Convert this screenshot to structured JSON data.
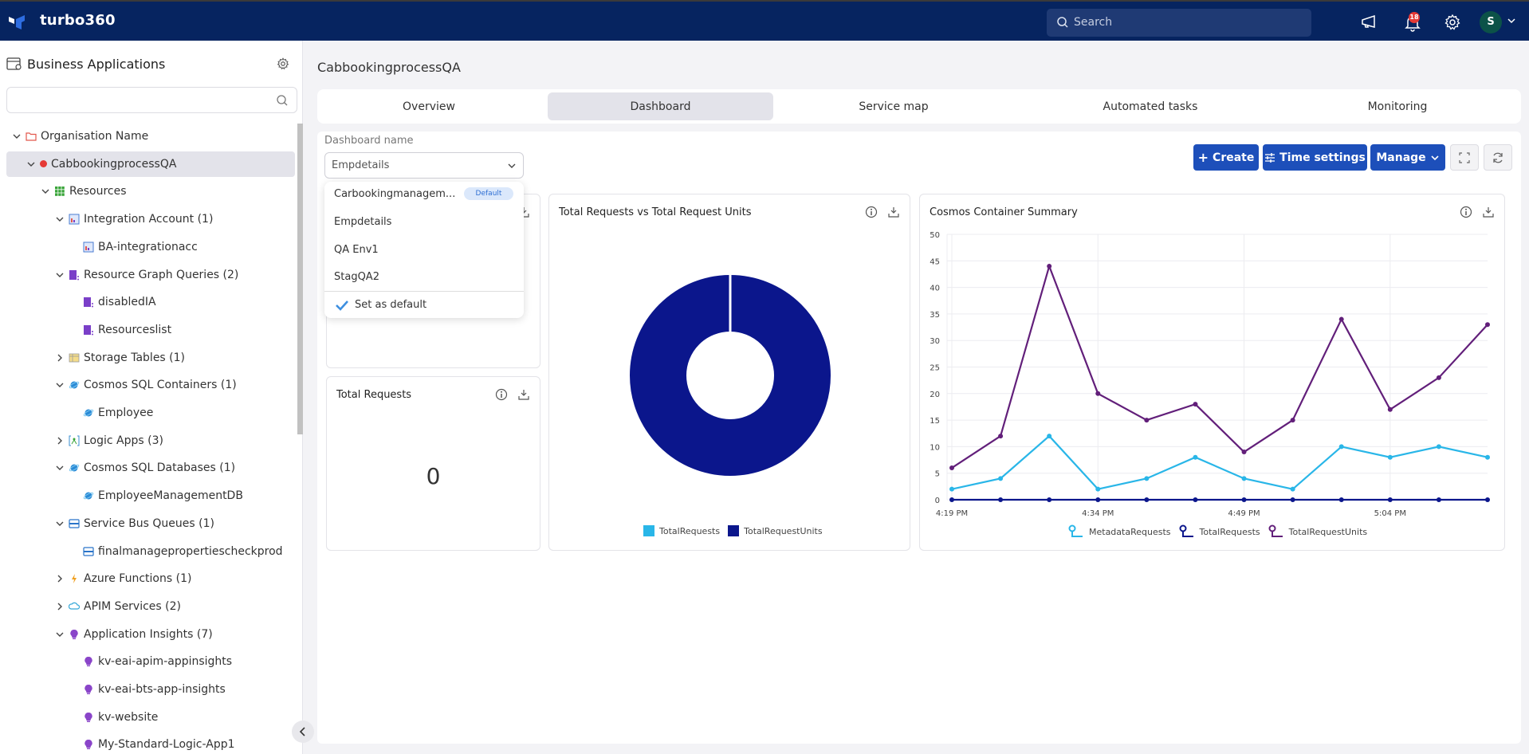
{
  "app": {
    "brand": "turbo360",
    "search_placeholder": "Search",
    "notification_count": "18",
    "avatar_initial": "S"
  },
  "sidebar": {
    "title": "Business Applications",
    "search_value": "",
    "tree": [
      {
        "label": "Organisation Name",
        "level": 0,
        "expanded": true,
        "icon": "folder-icon"
      },
      {
        "label": "CabbookingprocessQA",
        "level": 1,
        "expanded": true,
        "icon": "status-dot-icon",
        "selected": true
      },
      {
        "label": "Resources",
        "level": 2,
        "expanded": true,
        "icon": "grid-icon"
      },
      {
        "label": "Integration Account (1)",
        "level": 3,
        "expanded": true,
        "icon": "integration-account-icon"
      },
      {
        "label": "BA-integrationacc",
        "level": 4,
        "icon": "integration-account-icon"
      },
      {
        "label": "Resource Graph Queries (2)",
        "level": 3,
        "expanded": true,
        "icon": "resource-graph-icon"
      },
      {
        "label": "disabledIA",
        "level": 4,
        "icon": "resource-graph-icon"
      },
      {
        "label": "Resourceslist",
        "level": 4,
        "icon": "resource-graph-icon"
      },
      {
        "label": "Storage Tables (1)",
        "level": 3,
        "expanded": false,
        "icon": "storage-table-icon"
      },
      {
        "label": "Cosmos SQL Containers (1)",
        "level": 3,
        "expanded": true,
        "icon": "cosmos-icon"
      },
      {
        "label": "Employee",
        "level": 4,
        "icon": "cosmos-icon"
      },
      {
        "label": "Logic Apps (3)",
        "level": 3,
        "expanded": false,
        "icon": "logic-app-icon"
      },
      {
        "label": "Cosmos SQL Databases (1)",
        "level": 3,
        "expanded": true,
        "icon": "cosmos-icon"
      },
      {
        "label": "EmployeeManagementDB",
        "level": 4,
        "icon": "cosmos-icon"
      },
      {
        "label": "Service Bus Queues (1)",
        "level": 3,
        "expanded": true,
        "icon": "service-bus-icon"
      },
      {
        "label": "finalmanagepropertiescheckprod",
        "level": 4,
        "icon": "service-bus-icon"
      },
      {
        "label": "Azure Functions (1)",
        "level": 3,
        "expanded": false,
        "icon": "azure-function-icon"
      },
      {
        "label": "APIM Services (2)",
        "level": 3,
        "expanded": false,
        "icon": "apim-icon"
      },
      {
        "label": "Application Insights (7)",
        "level": 3,
        "expanded": true,
        "icon": "app-insights-icon"
      },
      {
        "label": "kv-eai-apim-appinsights",
        "level": 4,
        "icon": "app-insights-icon"
      },
      {
        "label": "kv-eai-bts-app-insights",
        "level": 4,
        "icon": "app-insights-icon"
      },
      {
        "label": "kv-website",
        "level": 4,
        "icon": "app-insights-icon"
      },
      {
        "label": "My-Standard-Logic-App1",
        "level": 4,
        "icon": "app-insights-icon"
      }
    ]
  },
  "main": {
    "title": "CabbookingprocessQA",
    "tabs": [
      {
        "label": "Overview",
        "active": false
      },
      {
        "label": "Dashboard",
        "active": true
      },
      {
        "label": "Service map",
        "active": false
      },
      {
        "label": "Automated tasks",
        "active": false
      },
      {
        "label": "Monitoring",
        "active": false
      }
    ],
    "dashboard_label": "Dashboard name",
    "dashboard_selected": "Empdetails",
    "dropdown": {
      "options": [
        {
          "label": "Carbookingmanagem...",
          "badge": "Default"
        },
        {
          "label": "Empdetails"
        },
        {
          "label": "QA Env1"
        },
        {
          "label": "StagQA2"
        }
      ],
      "set_default_label": "Set as default"
    },
    "toolbar": {
      "create_label": "Create",
      "time_settings_label": "Time settings",
      "manage_label": "Manage"
    },
    "widgets": {
      "total_requests": {
        "title": "Total Requests",
        "value": "0"
      }
    }
  },
  "colors": {
    "topbar": "#062460",
    "primary_button": "#1d4fba",
    "metadata_requests": "#29b6e8",
    "total_requests": "#0b168c",
    "total_request_units": "#621f7a"
  },
  "chart_data": [
    {
      "type": "pie",
      "title": "Total Requests vs Total Request Units",
      "donut": true,
      "labels": [
        "TotalRequests",
        "TotalRequestUnits"
      ],
      "values": [
        0,
        100
      ],
      "colors": [
        "#29b6e8",
        "#0b168c"
      ],
      "legend": "bottom"
    },
    {
      "type": "line",
      "title": "Cosmos Container Summary",
      "x": [
        "4:19 PM",
        "4:24 PM",
        "4:29 PM",
        "4:34 PM",
        "4:39 PM",
        "4:44 PM",
        "4:49 PM",
        "4:54 PM",
        "4:59 PM",
        "5:04 PM",
        "5:09 PM",
        "5:14 PM"
      ],
      "xtick_labels": [
        "4:19 PM",
        "4:34 PM",
        "4:49 PM",
        "5:04 PM"
      ],
      "series": [
        {
          "name": "MetadataRequests",
          "color": "#29b6e8",
          "values": [
            2,
            4,
            12,
            2,
            4,
            8,
            4,
            2,
            10,
            8,
            10,
            8
          ]
        },
        {
          "name": "TotalRequests",
          "color": "#0b168c",
          "values": [
            0,
            0,
            0,
            0,
            0,
            0,
            0,
            0,
            0,
            0,
            0,
            0
          ]
        },
        {
          "name": "TotalRequestUnits",
          "color": "#621f7a",
          "values": [
            6,
            12,
            44,
            20,
            15,
            18,
            9,
            15,
            34,
            17,
            23,
            33
          ]
        }
      ],
      "ylim": [
        0,
        50
      ],
      "yticks": [
        0,
        5,
        10,
        15,
        20,
        25,
        30,
        35,
        40,
        45,
        50
      ],
      "grid": true,
      "legend": "bottom"
    }
  ]
}
